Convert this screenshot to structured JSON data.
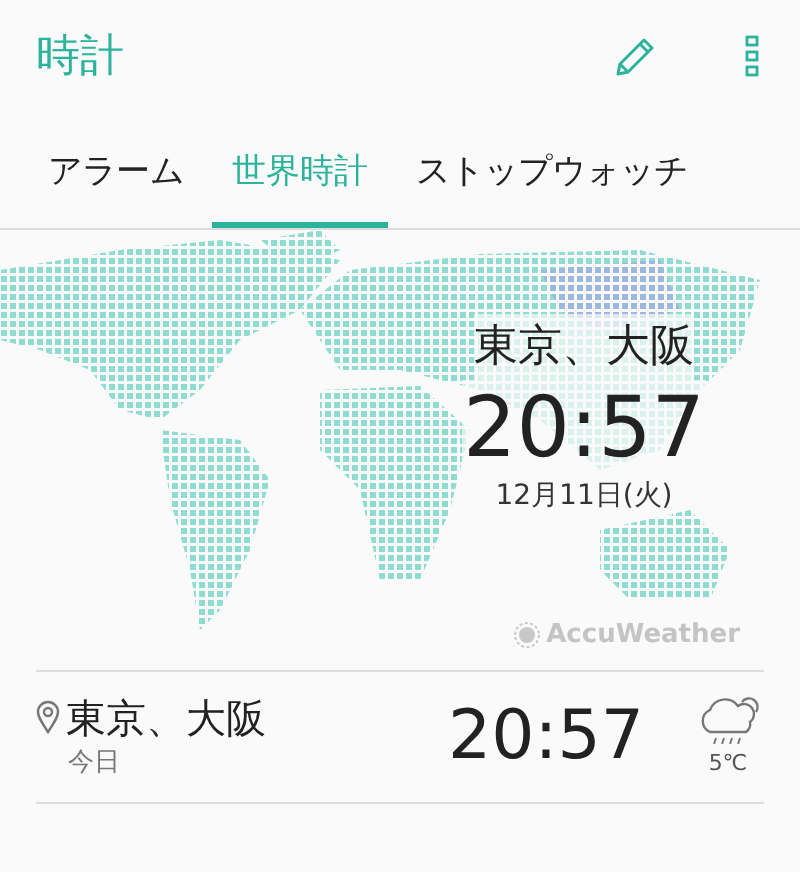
{
  "app_title": "時計",
  "tabs": [
    {
      "label": "アラーム",
      "selected": false
    },
    {
      "label": "世界時計",
      "selected": true
    },
    {
      "label": "ストップウォッチ",
      "selected": false
    }
  ],
  "world_clock": {
    "city": "東京、大阪",
    "time": "20:57",
    "date": "12月11日(火)"
  },
  "attribution": "AccuWeather",
  "clocks": [
    {
      "city": "東京、大阪",
      "day": "今日",
      "time": "20:57",
      "temperature": "5℃"
    }
  ]
}
